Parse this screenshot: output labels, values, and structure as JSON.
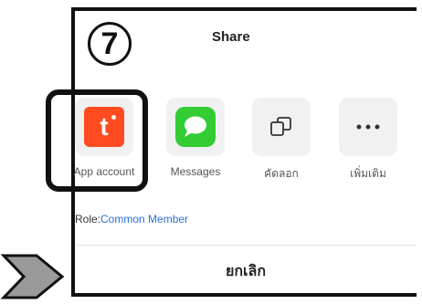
{
  "step": {
    "number": "7"
  },
  "sheet": {
    "title": "Share",
    "options": [
      {
        "label": "App account",
        "icon": "tuya-app-icon",
        "color": "#ff4b1f"
      },
      {
        "label": "Messages",
        "icon": "messages-icon",
        "color": "#33cc33"
      },
      {
        "label": "คัดลอก",
        "icon": "copy-icon"
      },
      {
        "label": "เพิ่มเติม",
        "icon": "more-icon"
      }
    ],
    "role_label": "Role:",
    "role_value": "Common Member",
    "role_value_color": "#2a6fd8",
    "cancel_label": "ยกเลิก"
  }
}
